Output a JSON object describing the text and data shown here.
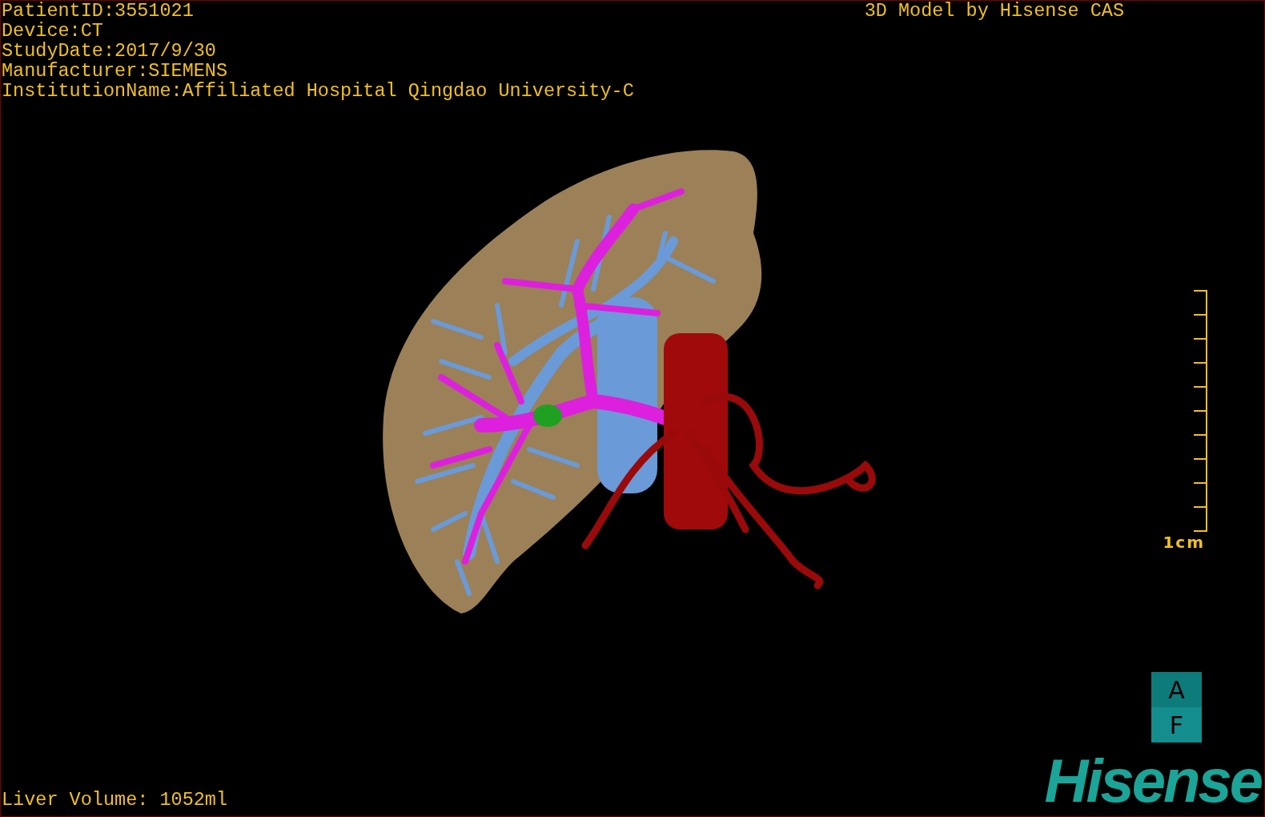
{
  "header": {
    "info_lines": [
      "PatientID:3551021",
      "Device:CT",
      "StudyDate:2017/9/30",
      "Manufacturer:SIEMENS",
      "InstitutionName:Affiliated Hospital Qingdao University-C"
    ],
    "title": "3D Model by Hisense CAS"
  },
  "scale_bar": {
    "label": "1cm"
  },
  "orientation": {
    "top": "A",
    "bottom": "F"
  },
  "logo": "Hisense",
  "footer": {
    "liver_volume": "Liver Volume: 1052ml"
  }
}
